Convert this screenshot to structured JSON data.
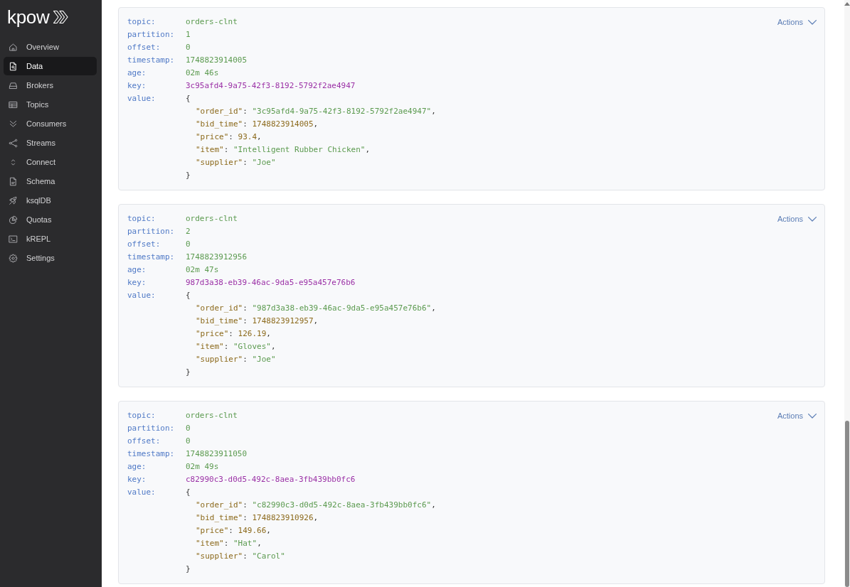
{
  "sidebar": {
    "logo": "kpow",
    "items": [
      {
        "label": "Overview",
        "selected": false
      },
      {
        "label": "Data",
        "selected": true
      },
      {
        "label": "Brokers",
        "selected": false
      },
      {
        "label": "Topics",
        "selected": false
      },
      {
        "label": "Consumers",
        "selected": false
      },
      {
        "label": "Streams",
        "selected": false
      },
      {
        "label": "Connect",
        "selected": false
      },
      {
        "label": "Schema",
        "selected": false
      },
      {
        "label": "ksqlDB",
        "selected": false
      },
      {
        "label": "Quotas",
        "selected": false
      },
      {
        "label": "kREPL",
        "selected": false
      },
      {
        "label": "Settings",
        "selected": false
      }
    ]
  },
  "messages": [
    {
      "actions": "Actions",
      "fields": [
        {
          "label": "topic:",
          "value": "orders-clnt",
          "kind": "meta"
        },
        {
          "label": "partition:",
          "value": "1",
          "kind": "meta"
        },
        {
          "label": "offset:",
          "value": "0",
          "kind": "meta"
        },
        {
          "label": "timestamp:",
          "value": "1748823914005",
          "kind": "meta"
        },
        {
          "label": "age:",
          "value": "02m 46s",
          "kind": "meta"
        },
        {
          "label": "key:",
          "value": "3c95afd4-9a75-42f3-8192-5792f2ae4947",
          "kind": "key"
        }
      ],
      "value": {
        "label": "value:",
        "open": "{",
        "lines": [
          {
            "key": "\"order_id\"",
            "colon": ":",
            "value": "\"3c95afd4-9a75-42f3-8192-5792f2ae4947\"",
            "kind": "string",
            "comma": ","
          },
          {
            "key": "\"bid_time\"",
            "colon": ":",
            "value": "1748823914005",
            "kind": "number",
            "comma": ","
          },
          {
            "key": "\"price\"",
            "colon": ":",
            "value": "93.4",
            "kind": "number",
            "comma": ","
          },
          {
            "key": "\"item\"",
            "colon": ":",
            "value": "\"Intelligent Rubber Chicken\"",
            "kind": "string",
            "comma": ","
          },
          {
            "key": "\"supplier\"",
            "colon": ":",
            "value": "\"Joe\"",
            "kind": "string"
          }
        ],
        "close": "}"
      }
    },
    {
      "actions": "Actions",
      "fields": [
        {
          "label": "topic:",
          "value": "orders-clnt",
          "kind": "meta"
        },
        {
          "label": "partition:",
          "value": "2",
          "kind": "meta"
        },
        {
          "label": "offset:",
          "value": "0",
          "kind": "meta"
        },
        {
          "label": "timestamp:",
          "value": "1748823912956",
          "kind": "meta"
        },
        {
          "label": "age:",
          "value": "02m 47s",
          "kind": "meta"
        },
        {
          "label": "key:",
          "value": "987d3a38-eb39-46ac-9da5-e95a457e76b6",
          "kind": "key"
        }
      ],
      "value": {
        "label": "value:",
        "open": "{",
        "lines": [
          {
            "key": "\"order_id\"",
            "colon": ":",
            "value": "\"987d3a38-eb39-46ac-9da5-e95a457e76b6\"",
            "kind": "string",
            "comma": ","
          },
          {
            "key": "\"bid_time\"",
            "colon": ":",
            "value": "1748823912957",
            "kind": "number",
            "comma": ","
          },
          {
            "key": "\"price\"",
            "colon": ":",
            "value": "126.19",
            "kind": "number",
            "comma": ","
          },
          {
            "key": "\"item\"",
            "colon": ":",
            "value": "\"Gloves\"",
            "kind": "string",
            "comma": ","
          },
          {
            "key": "\"supplier\"",
            "colon": ":",
            "value": "\"Joe\"",
            "kind": "string"
          }
        ],
        "close": "}"
      }
    },
    {
      "actions": "Actions",
      "fields": [
        {
          "label": "topic:",
          "value": "orders-clnt",
          "kind": "meta"
        },
        {
          "label": "partition:",
          "value": "0",
          "kind": "meta"
        },
        {
          "label": "offset:",
          "value": "0",
          "kind": "meta"
        },
        {
          "label": "timestamp:",
          "value": "1748823911050",
          "kind": "meta"
        },
        {
          "label": "age:",
          "value": "02m 49s",
          "kind": "meta"
        },
        {
          "label": "key:",
          "value": "c82990c3-d0d5-492c-8aea-3fb439bb0fc6",
          "kind": "key"
        }
      ],
      "value": {
        "label": "value:",
        "open": "{",
        "lines": [
          {
            "key": "\"order_id\"",
            "colon": ":",
            "value": "\"c82990c3-d0d5-492c-8aea-3fb439bb0fc6\"",
            "kind": "string",
            "comma": ","
          },
          {
            "key": "\"bid_time\"",
            "colon": ":",
            "value": "1748823910926",
            "kind": "number",
            "comma": ","
          },
          {
            "key": "\"price\"",
            "colon": ":",
            "value": "149.66",
            "kind": "number",
            "comma": ","
          },
          {
            "key": "\"item\"",
            "colon": ":",
            "value": "\"Hat\"",
            "kind": "string",
            "comma": ","
          },
          {
            "key": "\"supplier\"",
            "colon": ":",
            "value": "\"Carol\"",
            "kind": "string"
          }
        ],
        "close": "}"
      }
    }
  ]
}
